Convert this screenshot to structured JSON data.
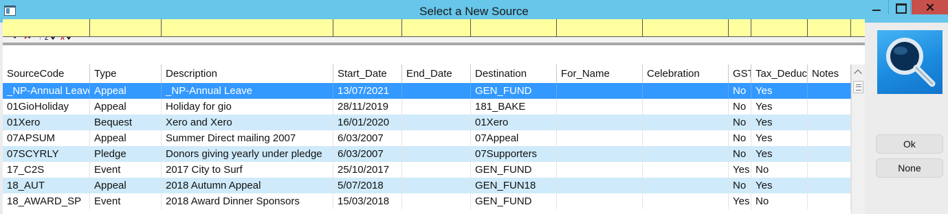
{
  "window": {
    "title": "Select a New Source"
  },
  "toolbar": {
    "icons": [
      "filter-icon",
      "clear-filter-icon",
      "sort-ascending-icon",
      "sort-descending-icon"
    ]
  },
  "grid": {
    "columns": [
      "SourceCode",
      "Type",
      "Description",
      "Start_Date",
      "End_Date",
      "Destination",
      "For_Name",
      "Celebration",
      "GST",
      "Tax_Deduc",
      "Notes"
    ],
    "rows": [
      {
        "SourceCode": "_NP-Annual Leave",
        "Type": "Appeal",
        "Description": "_NP-Annual Leave",
        "Start_Date": "13/07/2021",
        "End_Date": "",
        "Destination": "GEN_FUND",
        "For_Name": "",
        "Celebration": "",
        "GST": "No",
        "Tax_Deduc": "Yes",
        "Notes": ""
      },
      {
        "SourceCode": "01GioHoliday",
        "Type": "Appeal",
        "Description": "Holiday for gio",
        "Start_Date": "28/11/2019",
        "End_Date": "",
        "Destination": "181_BAKE",
        "For_Name": "",
        "Celebration": "",
        "GST": "No",
        "Tax_Deduc": "Yes",
        "Notes": ""
      },
      {
        "SourceCode": "01Xero",
        "Type": "Bequest",
        "Description": "Xero and Xero",
        "Start_Date": "16/01/2020",
        "End_Date": "",
        "Destination": "01Xero",
        "For_Name": "",
        "Celebration": "",
        "GST": "No",
        "Tax_Deduc": "Yes",
        "Notes": ""
      },
      {
        "SourceCode": "07APSUM",
        "Type": "Appeal",
        "Description": "Summer Direct mailing 2007",
        "Start_Date": "6/03/2007",
        "End_Date": "",
        "Destination": "07Appeal",
        "For_Name": "",
        "Celebration": "",
        "GST": "No",
        "Tax_Deduc": "Yes",
        "Notes": ""
      },
      {
        "SourceCode": "07SCYRLY",
        "Type": "Pledge",
        "Description": "Donors giving yearly under pledge",
        "Start_Date": "6/03/2007",
        "End_Date": "",
        "Destination": "07Supporters",
        "For_Name": "",
        "Celebration": "",
        "GST": "No",
        "Tax_Deduc": "Yes",
        "Notes": ""
      },
      {
        "SourceCode": "17_C2S",
        "Type": "Event",
        "Description": "2017 City to Surf",
        "Start_Date": "25/10/2017",
        "End_Date": "",
        "Destination": "GEN_FUND",
        "For_Name": "",
        "Celebration": "",
        "GST": "Yes",
        "Tax_Deduc": "No",
        "Notes": ""
      },
      {
        "SourceCode": "18_AUT",
        "Type": "Appeal",
        "Description": "2018 Autumn Appeal",
        "Start_Date": "5/07/2018",
        "End_Date": "",
        "Destination": "GEN_FUN18",
        "For_Name": "",
        "Celebration": "",
        "GST": "No",
        "Tax_Deduc": "Yes",
        "Notes": ""
      },
      {
        "SourceCode": "18_AWARD_SP",
        "Type": "Event",
        "Description": "2018 Award Dinner Sponsors",
        "Start_Date": "15/03/2018",
        "End_Date": "",
        "Destination": "GEN_FUND",
        "For_Name": "",
        "Celebration": "",
        "GST": "Yes",
        "Tax_Deduc": "No",
        "Notes": ""
      }
    ]
  },
  "side": {
    "ok_label": "Ok",
    "none_label": "None",
    "icon": "search-magnifier-icon"
  },
  "colors": {
    "titlebar": "#67c6ea",
    "selection": "#3399ff",
    "row_alt": "#cfeafa",
    "filter_row": "#ffffa0",
    "close": "#c7504a"
  }
}
